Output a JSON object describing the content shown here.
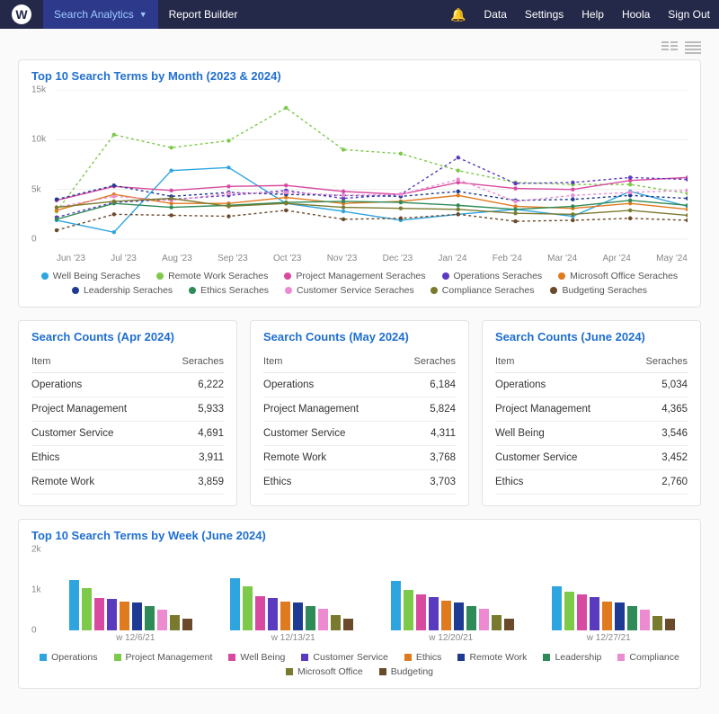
{
  "topbar": {
    "logo": "W",
    "active": "Search Analytics",
    "second": "Report Builder",
    "links": [
      "Data",
      "Settings",
      "Help",
      "Hoola",
      "Sign Out"
    ]
  },
  "card1_title": "Top 10 Search Terms by Month (2023 & 2024)",
  "chart_data": {
    "type": "line",
    "title": "Top 10 Search Terms by Month (2023 & 2024)",
    "xlabel": "",
    "ylabel": "",
    "ylim": [
      0,
      15000
    ],
    "yticks": [
      0,
      5000,
      10000,
      15000
    ],
    "ytick_labels": [
      "0",
      "5k",
      "10k",
      "15k"
    ],
    "categories": [
      "Jun '23",
      "Jul '23",
      "Aug '23",
      "Sep '23",
      "Oct '23",
      "Nov '23",
      "Dec '23",
      "Jan '24",
      "Feb '24",
      "Mar '24",
      "Apr '24",
      "May '24"
    ],
    "series": [
      {
        "name": "Well Being Seraches",
        "color": "#2fa5e0",
        "values": [
          1900,
          700,
          6900,
          7200,
          3600,
          2800,
          1900,
          2500,
          3000,
          2300,
          4800,
          3300
        ]
      },
      {
        "name": "Remote Work Seraches",
        "color": "#7dc94a",
        "values": [
          2800,
          10500,
          9200,
          9900,
          13200,
          9000,
          8600,
          6900,
          5700,
          5500,
          5500,
          4600
        ]
      },
      {
        "name": "Project Management Seraches",
        "color": "#d84a9f",
        "values": [
          3900,
          5300,
          4900,
          5300,
          5400,
          4800,
          4500,
          5700,
          5100,
          5000,
          5900,
          6200
        ]
      },
      {
        "name": "Operations Seraches",
        "color": "#5a3bbf",
        "values": [
          2200,
          3700,
          4000,
          4400,
          4900,
          4100,
          4500,
          8200,
          5600,
          5700,
          6200,
          6000
        ]
      },
      {
        "name": "Microsoft Office Seraches",
        "color": "#e07a1f",
        "values": [
          2900,
          4500,
          3600,
          3600,
          4200,
          3600,
          3800,
          4400,
          3300,
          3100,
          3600,
          3000
        ]
      },
      {
        "name": "Leadership Seraches",
        "color": "#1f3a93",
        "values": [
          4000,
          5400,
          4300,
          4700,
          4500,
          4400,
          4300,
          4800,
          3900,
          4000,
          4400,
          4100
        ]
      },
      {
        "name": "Ethics Seraches",
        "color": "#2e8b57",
        "values": [
          2000,
          3600,
          3200,
          3400,
          3700,
          3800,
          3700,
          3400,
          3000,
          3300,
          3900,
          3400
        ]
      },
      {
        "name": "Customer Service Seraches",
        "color": "#ec8bd0",
        "values": [
          3200,
          4300,
          3900,
          4600,
          4700,
          4400,
          4500,
          6000,
          3800,
          4400,
          4700,
          4900
        ]
      },
      {
        "name": "Compliance Seraches",
        "color": "#7a7a2e",
        "values": [
          3200,
          3800,
          4100,
          3300,
          3600,
          3200,
          3100,
          3000,
          2600,
          2500,
          2900,
          2400
        ]
      },
      {
        "name": "Budgeting Seraches",
        "color": "#6b4a2b",
        "values": [
          900,
          2500,
          2400,
          2300,
          2900,
          2000,
          2100,
          2500,
          1800,
          1900,
          2100,
          1900
        ]
      }
    ]
  },
  "counts": [
    {
      "title": "Search Counts (Apr 2024)",
      "headers": [
        "Item",
        "Seraches"
      ],
      "rows": [
        [
          "Operations",
          "6,222"
        ],
        [
          "Project Management",
          "5,933"
        ],
        [
          "Customer Service",
          "4,691"
        ],
        [
          "Ethics",
          "3,911"
        ],
        [
          "Remote Work",
          "3,859"
        ]
      ]
    },
    {
      "title": "Search Counts (May 2024)",
      "headers": [
        "Item",
        "Seraches"
      ],
      "rows": [
        [
          "Operations",
          "6,184"
        ],
        [
          "Project Management",
          "5,824"
        ],
        [
          "Customer Service",
          "4,311"
        ],
        [
          "Remote Work",
          "3,768"
        ],
        [
          "Ethics",
          "3,703"
        ]
      ]
    },
    {
      "title": "Search Counts (June 2024)",
      "headers": [
        "Item",
        "Seraches"
      ],
      "rows": [
        [
          "Operations",
          "5,034"
        ],
        [
          "Project Management",
          "4,365"
        ],
        [
          "Well Being",
          "3,546"
        ],
        [
          "Customer Service",
          "3,452"
        ],
        [
          "Ethics",
          "2,760"
        ]
      ]
    }
  ],
  "card2_title": "Top 10 Search Terms by Week (June 2024)",
  "bar_data": {
    "type": "bar",
    "title": "Top 10 Search Terms by Week (June 2024)",
    "ylim": [
      0,
      2000
    ],
    "yticks": [
      0,
      1000,
      2000
    ],
    "ytick_labels": [
      "0",
      "1k",
      "2k"
    ],
    "categories": [
      "w 12/6/21",
      "w 12/13/21",
      "w 12/20/21",
      "w 12/27/21"
    ],
    "series": [
      {
        "name": "Operations",
        "color": "#2fa5e0",
        "values": [
          1250,
          1280,
          1220,
          1100
        ]
      },
      {
        "name": "Project Management",
        "color": "#7dc94a",
        "values": [
          1050,
          1100,
          1000,
          950
        ]
      },
      {
        "name": "Well Being",
        "color": "#d84a9f",
        "values": [
          800,
          850,
          900,
          880
        ]
      },
      {
        "name": "Customer Service",
        "color": "#5a3bbf",
        "values": [
          780,
          800,
          820,
          830
        ]
      },
      {
        "name": "Ethics",
        "color": "#e07a1f",
        "values": [
          720,
          720,
          730,
          720
        ]
      },
      {
        "name": "Remote Work",
        "color": "#1f3a93",
        "values": [
          680,
          700,
          690,
          680
        ]
      },
      {
        "name": "Leadership",
        "color": "#2e8b57",
        "values": [
          600,
          610,
          600,
          590
        ]
      },
      {
        "name": "Compliance",
        "color": "#ec8bd0",
        "values": [
          520,
          530,
          540,
          520
        ]
      },
      {
        "name": "Microsoft Office",
        "color": "#7a7a2e",
        "values": [
          380,
          380,
          370,
          360
        ]
      },
      {
        "name": "Budgeting",
        "color": "#6b4a2b",
        "values": [
          300,
          300,
          290,
          280
        ]
      }
    ]
  }
}
